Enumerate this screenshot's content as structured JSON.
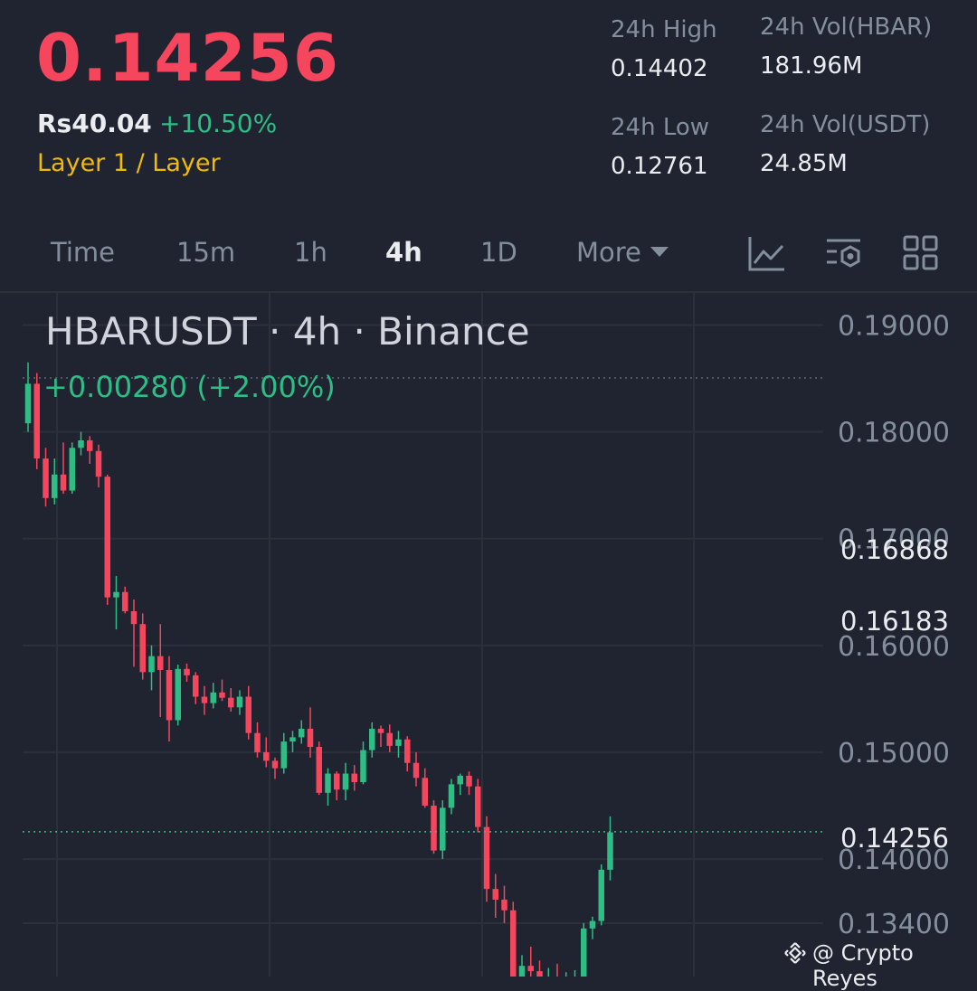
{
  "header": {
    "last_price": "0.14256",
    "fiat_price": "Rs40.04",
    "change_pct": "+10.50%",
    "category": "Layer 1 / Layer",
    "stats": {
      "high_label": "24h High",
      "high_value": "0.14402",
      "low_label": "24h Low",
      "low_value": "0.12761",
      "vol_base_label": "24h Vol(HBAR)",
      "vol_base_value": "181.96M",
      "vol_quote_label": "24h Vol(USDT)",
      "vol_quote_value": "24.85M"
    }
  },
  "tabs": {
    "items": [
      "Time",
      "15m",
      "1h",
      "4h",
      "1D",
      "More"
    ],
    "active": "4h"
  },
  "toolbar_icons": [
    "line-chart-icon",
    "indicator-settings-icon",
    "grid-layout-icon"
  ],
  "colors": {
    "up": "#2ebd85",
    "down": "#f6465d",
    "background": "#1f2430",
    "accent": "#f0b90b"
  },
  "chart_data": {
    "type": "candlestick",
    "symbol_line": "HBARUSDT · 4h · Binance",
    "change_line": "+0.00280 (+2.00%)",
    "y_ticks": [
      "0.19000",
      "0.18000",
      "0.17000",
      "0.16000",
      "0.15000",
      "0.14000",
      "0.13400"
    ],
    "price_tags": [
      {
        "value": "0.16868",
        "color": "#7c808a"
      },
      {
        "value": "0.16183",
        "color": "#8b1a22"
      },
      {
        "value": "0.14256",
        "color": "#2ebd85"
      }
    ],
    "candles": [
      [
        0.1808,
        0.1865,
        0.18,
        0.1845
      ],
      [
        0.1845,
        0.1855,
        0.1765,
        0.1775
      ],
      [
        0.1775,
        0.1785,
        0.173,
        0.1738
      ],
      [
        0.1738,
        0.1775,
        0.1732,
        0.176
      ],
      [
        0.176,
        0.179,
        0.1742,
        0.1745
      ],
      [
        0.1745,
        0.179,
        0.1742,
        0.1785
      ],
      [
        0.1785,
        0.18,
        0.1778,
        0.1792
      ],
      [
        0.1792,
        0.1796,
        0.177,
        0.1782
      ],
      [
        0.1782,
        0.1788,
        0.1748,
        0.1758
      ],
      [
        0.1758,
        0.176,
        0.1638,
        0.1645
      ],
      [
        0.1645,
        0.1665,
        0.1615,
        0.165
      ],
      [
        0.165,
        0.1655,
        0.163,
        0.1632
      ],
      [
        0.1632,
        0.1643,
        0.158,
        0.162
      ],
      [
        0.162,
        0.163,
        0.1568,
        0.1575
      ],
      [
        0.1575,
        0.16,
        0.1558,
        0.159
      ],
      [
        0.159,
        0.162,
        0.1533,
        0.1577
      ],
      [
        0.1577,
        0.159,
        0.151,
        0.153
      ],
      [
        0.153,
        0.1582,
        0.1525,
        0.1578
      ],
      [
        0.1578,
        0.1583,
        0.1566,
        0.1572
      ],
      [
        0.1572,
        0.1575,
        0.1545,
        0.1552
      ],
      [
        0.1552,
        0.1562,
        0.1535,
        0.1546
      ],
      [
        0.1546,
        0.1565,
        0.1541,
        0.1556
      ],
      [
        0.1556,
        0.1568,
        0.1548,
        0.1551
      ],
      [
        0.1551,
        0.156,
        0.1538,
        0.1542
      ],
      [
        0.1542,
        0.1558,
        0.1535,
        0.1552
      ],
      [
        0.1552,
        0.1562,
        0.1512,
        0.1518
      ],
      [
        0.1518,
        0.1528,
        0.1495,
        0.15
      ],
      [
        0.15,
        0.1514,
        0.1486,
        0.1492
      ],
      [
        0.1492,
        0.1495,
        0.1475,
        0.1485
      ],
      [
        0.1485,
        0.1518,
        0.148,
        0.151
      ],
      [
        0.151,
        0.152,
        0.15,
        0.1514
      ],
      [
        0.1514,
        0.153,
        0.1508,
        0.1522
      ],
      [
        0.1522,
        0.1542,
        0.1495,
        0.1505
      ],
      [
        0.1505,
        0.151,
        0.146,
        0.1462
      ],
      [
        0.1462,
        0.1485,
        0.145,
        0.148
      ],
      [
        0.148,
        0.1482,
        0.1455,
        0.1465
      ],
      [
        0.1465,
        0.149,
        0.1455,
        0.148
      ],
      [
        0.148,
        0.1488,
        0.1464,
        0.1472
      ],
      [
        0.1472,
        0.151,
        0.147,
        0.1502
      ],
      [
        0.1502,
        0.1528,
        0.1495,
        0.1522
      ],
      [
        0.1522,
        0.1525,
        0.1505,
        0.1518
      ],
      [
        0.1518,
        0.1526,
        0.15,
        0.1506
      ],
      [
        0.1506,
        0.152,
        0.1495,
        0.1512
      ],
      [
        0.1512,
        0.1515,
        0.1482,
        0.149
      ],
      [
        0.149,
        0.15,
        0.1468,
        0.1476
      ],
      [
        0.1476,
        0.1485,
        0.1448,
        0.145
      ],
      [
        0.145,
        0.1455,
        0.1405,
        0.1408
      ],
      [
        0.1408,
        0.1455,
        0.14,
        0.1448
      ],
      [
        0.1448,
        0.1475,
        0.1442,
        0.147
      ],
      [
        0.147,
        0.148,
        0.146,
        0.1478
      ],
      [
        0.1478,
        0.1482,
        0.146,
        0.1468
      ],
      [
        0.1468,
        0.1475,
        0.1425,
        0.143
      ],
      [
        0.143,
        0.144,
        0.136,
        0.1372
      ],
      [
        0.1372,
        0.1386,
        0.1345,
        0.1362
      ],
      [
        0.1362,
        0.1375,
        0.134,
        0.1352
      ],
      [
        0.1352,
        0.136,
        0.127,
        0.1278
      ],
      [
        0.1278,
        0.131,
        0.1268,
        0.13
      ],
      [
        0.13,
        0.1318,
        0.1285,
        0.1295
      ],
      [
        0.1295,
        0.1305,
        0.1278,
        0.1285
      ],
      [
        0.1285,
        0.1298,
        0.1272,
        0.129
      ],
      [
        0.129,
        0.1302,
        0.1276,
        0.1282
      ],
      [
        0.1282,
        0.1294,
        0.127,
        0.1286
      ],
      [
        0.1286,
        0.1296,
        0.128,
        0.129
      ],
      [
        0.129,
        0.134,
        0.1285,
        0.1335
      ],
      [
        0.1335,
        0.1346,
        0.1325,
        0.1342
      ],
      [
        0.1342,
        0.1395,
        0.1338,
        0.139
      ],
      [
        0.139,
        0.144,
        0.138,
        0.1425
      ]
    ],
    "y_range": [
      0.129,
      0.193
    ]
  },
  "watermark": {
    "text": "@ Crypto Reyes"
  }
}
